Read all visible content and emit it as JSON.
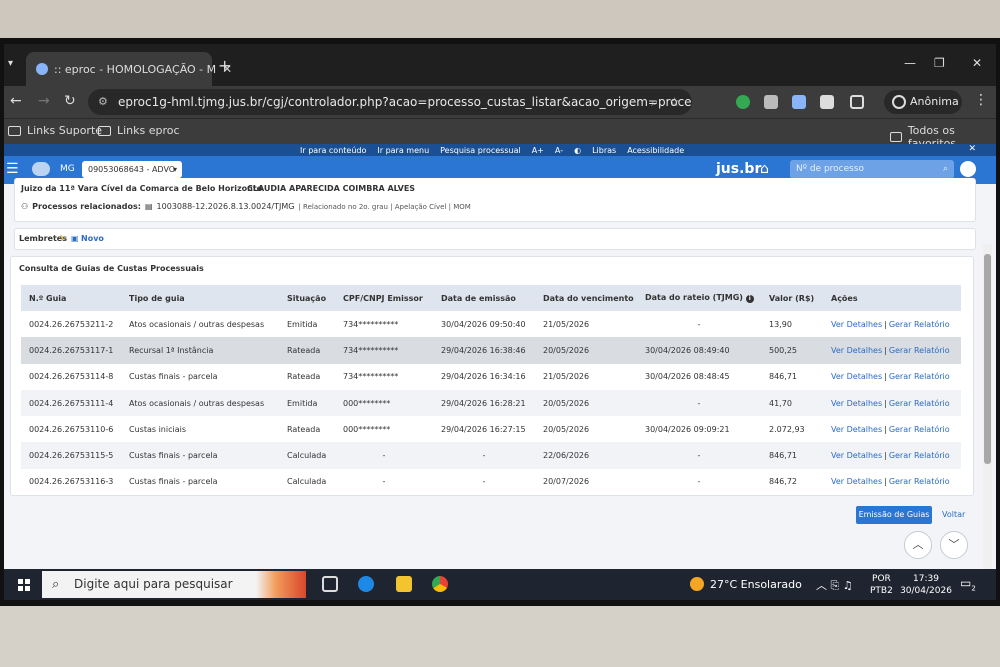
{
  "browser": {
    "tab_title": ":: eproc - HOMOLOGAÇÃO - M",
    "url": "eproc1g-hml.tjmg.jus.br/cgj/controlador.php?acao=processo_custas_listar&acao_origem=processo_consultar&...",
    "profile_label": "Anônima",
    "bookmarks": [
      "Links Suporte",
      "Links eproc"
    ],
    "all_bookmarks": "Todos os favoritos"
  },
  "accessibility_bar": {
    "items": [
      "Ir para conteúdo",
      "Ir para menu",
      "Pesquisa processual",
      "A+",
      "A-",
      "◐",
      "Libras",
      "Acessibilidade"
    ]
  },
  "header": {
    "state": "MG",
    "profile_select": "09053068643 - ADVO",
    "brand": "jus.br",
    "search_placeholder": "Nº de processo"
  },
  "process": {
    "court": "Juizo da 11ª Vara Cível da Comarca de Belo Horizonte",
    "party": "CLAUDIA APARECIDA COIMBRA ALVES",
    "related_label": "Processos relacionados:",
    "related_number": "1003088-12.2026.8.13.0024/TJMG",
    "related_desc": "| Relacionado no 2o. grau | Apelação Cível | MOM"
  },
  "reminders": {
    "label": "Lembretes",
    "new_label": "Novo"
  },
  "guides": {
    "title": "Consulta de Guias de Custas Processuais",
    "columns": [
      "N.º Guia",
      "Tipo de guia",
      "Situação",
      "CPF/CNPJ Emissor",
      "Data de emissão",
      "Data do vencimento",
      "Data do rateio (TJMG)",
      "Valor (R$)",
      "Ações"
    ],
    "rows": [
      [
        "0024.26.26753211-2",
        "Atos ocasionais / outras despesas",
        "Emitida",
        "734**********",
        "30/04/2026 09:50:40",
        "21/05/2026",
        "-",
        "13,90"
      ],
      [
        "0024.26.26753117-1",
        "Recursal 1ª Instância",
        "Rateada",
        "734**********",
        "29/04/2026 16:38:46",
        "20/05/2026",
        "30/04/2026 08:49:40",
        "500,25"
      ],
      [
        "0024.26.26753114-8",
        "Custas finais - parcela",
        "Rateada",
        "734**********",
        "29/04/2026 16:34:16",
        "21/05/2026",
        "30/04/2026 08:48:45",
        "846,71"
      ],
      [
        "0024.26.26753111-4",
        "Atos ocasionais / outras despesas",
        "Emitida",
        "000********",
        "29/04/2026 16:28:21",
        "20/05/2026",
        "-",
        "41,70"
      ],
      [
        "0024.26.26753110-6",
        "Custas iniciais",
        "Rateada",
        "000********",
        "29/04/2026 16:27:15",
        "20/05/2026",
        "30/04/2026 09:09:21",
        "2.072,93"
      ],
      [
        "0024.26.26753115-5",
        "Custas finais - parcela",
        "Calculada",
        "-",
        "-",
        "22/06/2026",
        "-",
        "846,71"
      ],
      [
        "0024.26.26753116-3",
        "Custas finais - parcela",
        "Calculada",
        "-",
        "-",
        "20/07/2026",
        "-",
        "846,72"
      ]
    ],
    "action_details": "Ver Detalhes",
    "action_sep": "|",
    "action_report": "Gerar Relatório"
  },
  "buttons": {
    "emit": "Emissão de Guias",
    "back": "Voltar"
  },
  "taskbar": {
    "search_placeholder": "Digite aqui para pesquisar",
    "weather": "27°C  Ensolarado",
    "lang": "POR",
    "layout": "PTB2",
    "time": "17:39",
    "date": "30/04/2026",
    "notifications": "2"
  }
}
